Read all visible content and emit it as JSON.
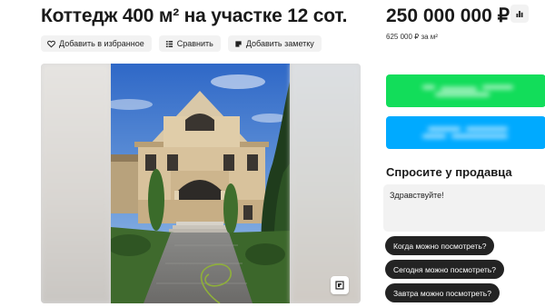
{
  "listing": {
    "title": "Коттедж 400 м² на участке 12 сот.",
    "actions": [
      {
        "label": "Добавить в избранное",
        "icon": "heart-icon"
      },
      {
        "label": "Сравнить",
        "icon": "compare-icon"
      },
      {
        "label": "Добавить заметку",
        "icon": "note-icon"
      }
    ],
    "gallery": {
      "icon": "fullscreen-icon"
    }
  },
  "sidebar": {
    "price": "250 000 000 ₽",
    "price_per_unit": "625 000 ₽ за м²",
    "stats_icon": "bar-chart-icon",
    "contact_buttons": [
      {
        "color": "#12dd5a",
        "label_hidden": true
      },
      {
        "color": "#00aaff",
        "label_hidden": true
      }
    ],
    "ask_seller": {
      "title": "Спросите у продавца",
      "message": "Здравствуйте!",
      "quick_questions": [
        "Когда можно посмотреть?",
        "Сегодня можно посмотреть?",
        "Завтра можно посмотреть?"
      ]
    }
  }
}
